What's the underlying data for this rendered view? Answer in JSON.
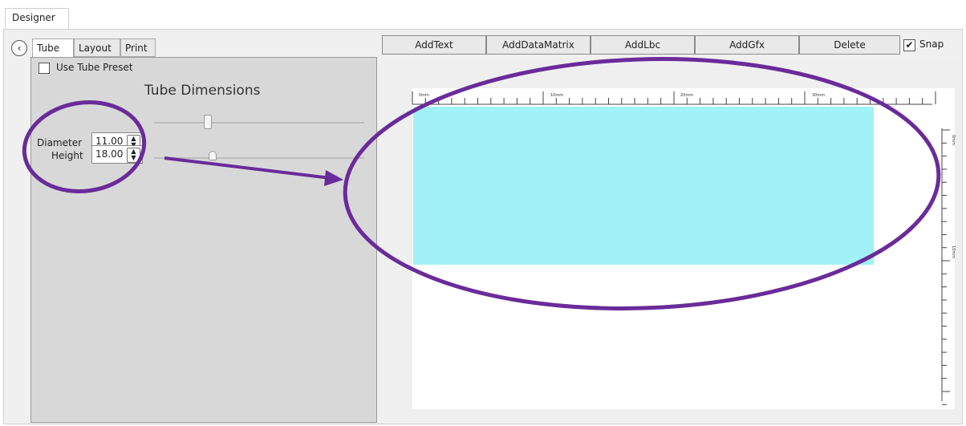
{
  "window": {
    "tab": "Designer"
  },
  "left_panel": {
    "back_icon": "‹",
    "tabs": [
      {
        "label": "Tube",
        "active": true
      },
      {
        "label": "Layout",
        "active": false
      },
      {
        "label": "Print",
        "active": false
      }
    ],
    "preset": {
      "label": "Use Tube Preset",
      "checked": false
    },
    "section_title": "Tube Dimensions",
    "diameter": {
      "label": "Diameter",
      "value": "11.00"
    },
    "height": {
      "label": "Height",
      "value": "18.00"
    }
  },
  "toolbar": {
    "buttons": [
      "AddText",
      "AddDataMatrix",
      "AddLbc",
      "AddGfx",
      "Delete"
    ],
    "snap": {
      "label": "Snap",
      "checked": true,
      "check_glyph": "✔"
    }
  },
  "canvas": {
    "ruler_labels": [
      "0mm",
      "10mm",
      "20mm",
      "30mm"
    ],
    "vruler_labels": [
      "0mm",
      "10mm"
    ],
    "label_color": "#a0f2f6"
  },
  "annotation": {
    "color": "#6a2b9a"
  }
}
